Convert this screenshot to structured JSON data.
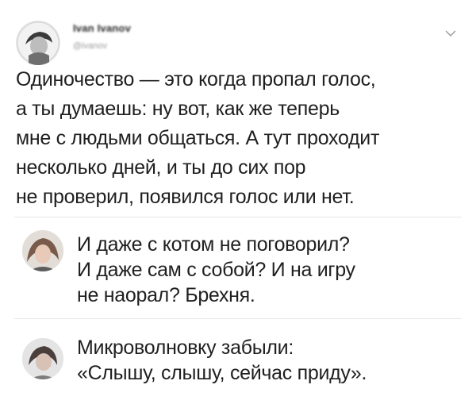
{
  "tweet": {
    "author_name": "Ivan Ivanov",
    "author_handle": "@ivanov",
    "lines": [
      "Одиночество — это когда пропал голос,",
      "а ты думаешь: ну вот, как же теперь",
      "мне с людьми общаться. А тут проходит",
      "несколько дней, и ты до сих пор",
      "не проверил, появился голос или нет."
    ],
    "menu_icon": "chevron-down-icon"
  },
  "replies": [
    {
      "lines": [
        "И даже с котом не поговорил?",
        "И даже сам с собой? И на игру",
        "не наорал? Брехня."
      ]
    },
    {
      "lines": [
        "Микроволновку забыли:",
        "«Слышу, слышу, сейчас приду»."
      ]
    }
  ],
  "colors": {
    "text": "#1f1f1f",
    "muted": "#9a9a9a",
    "divider": "#e6e6e6"
  }
}
